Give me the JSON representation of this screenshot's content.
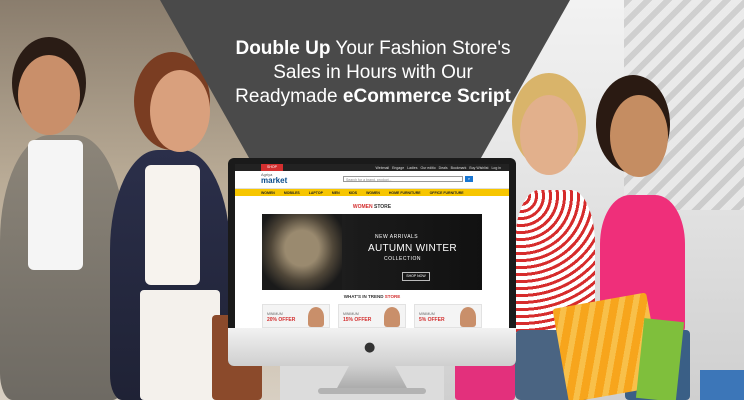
{
  "headline": {
    "line1_bold": "Double Up",
    "line1_rest": " Your Fashion Store's",
    "line2": "Sales in Hours with Our",
    "line3_start": "Readymade ",
    "line3_bold": "eCommerce Script"
  },
  "site": {
    "badge": "SHOP",
    "logo_small": "Agriya",
    "logo_main": "market",
    "topbar_links": [
      "Webmail",
      "Engage",
      "Ladies",
      "Our editio",
      "Deals",
      "Bookmark",
      "Buy Wishlist",
      "Log in"
    ],
    "search_placeholder": "Search for a brand, product...",
    "search_icon": "search-icon",
    "nav": [
      "WOMEN",
      "MOBILES",
      "LAPTOP",
      "MEN",
      "KIDS",
      "WOMEN",
      "HOME FURNITURE",
      "OFFICE FURNITURE"
    ],
    "section_title_a": "WOMEN",
    "section_title_b": " STORE",
    "hero": {
      "line1": "NEW ARRIVALS",
      "line2": "AUTUMN WINTER",
      "line3": "COLLECTION",
      "button": "SHOP NOW"
    },
    "trend_a": "WHAT'S IN TREND",
    "trend_b": " STORE",
    "offers": [
      {
        "label": "MINIMUM",
        "value": "20% OFFER"
      },
      {
        "label": "MINIMUM",
        "value": "15% OFFER"
      },
      {
        "label": "MINIMUM",
        "value": "5% OFFER"
      }
    ]
  },
  "colors": {
    "banner": "#4a4a4a",
    "nav": "#f7c600",
    "accent": "#d32f2f",
    "brand": "#0b4d8c"
  },
  "device": {
    "logo_icon": "apple-logo-icon"
  }
}
